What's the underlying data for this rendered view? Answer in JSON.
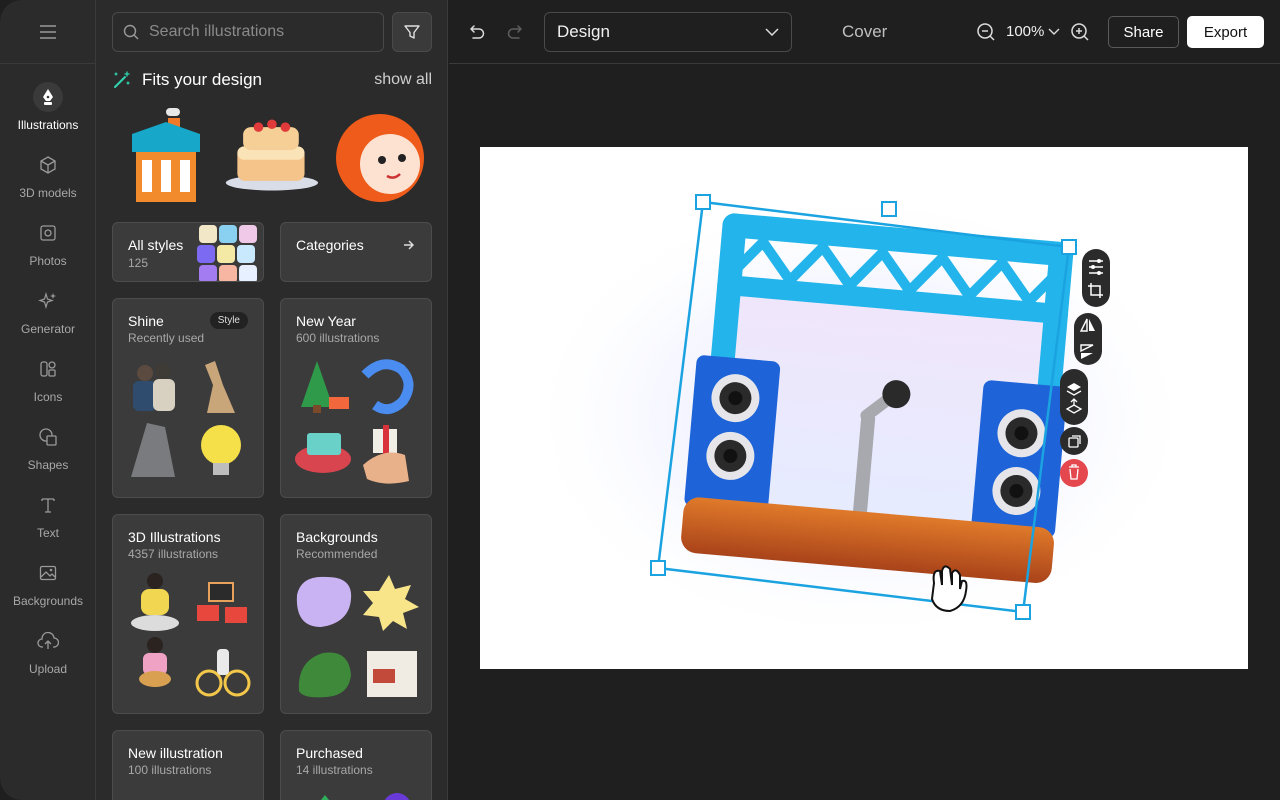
{
  "colors": {
    "accent": "#1aa3e0",
    "delete": "#e5474e",
    "panel_bg": "#2b2b2b",
    "canvas_bg": "#1f1f1f"
  },
  "rail": {
    "items": [
      {
        "label": "Illustrations",
        "icon": "pen-nib-icon",
        "active": true
      },
      {
        "label": "3D models",
        "icon": "cube-icon"
      },
      {
        "label": "Photos",
        "icon": "photo-icon"
      },
      {
        "label": "Generator",
        "icon": "sparkles-icon"
      },
      {
        "label": "Icons",
        "icon": "icons-icon"
      },
      {
        "label": "Shapes",
        "icon": "shapes-icon"
      },
      {
        "label": "Text",
        "icon": "text-icon"
      },
      {
        "label": "Backgrounds",
        "icon": "image-icon"
      },
      {
        "label": "Upload",
        "icon": "upload-cloud-icon"
      }
    ]
  },
  "panel": {
    "search_placeholder": "Search illustrations",
    "fits_title": "Fits your design",
    "show_all": "show all",
    "all_styles": {
      "title": "All styles",
      "count": "125"
    },
    "categories": {
      "title": "Categories"
    },
    "cards": [
      {
        "title": "Shine",
        "sub": "Recently used",
        "badge": "Style"
      },
      {
        "title": "New Year",
        "sub": "600 illustrations"
      },
      {
        "title": "3D Illustrations",
        "sub": "4357 illustrations"
      },
      {
        "title": "Backgrounds",
        "sub": "Recommended"
      },
      {
        "title": "New illustration",
        "sub": "100 illustrations"
      },
      {
        "title": "Purchased",
        "sub": "14 illustrations"
      }
    ]
  },
  "topbar": {
    "design_select": "Design",
    "page_label": "Cover",
    "zoom": "100%",
    "share": "Share",
    "export": "Export"
  }
}
